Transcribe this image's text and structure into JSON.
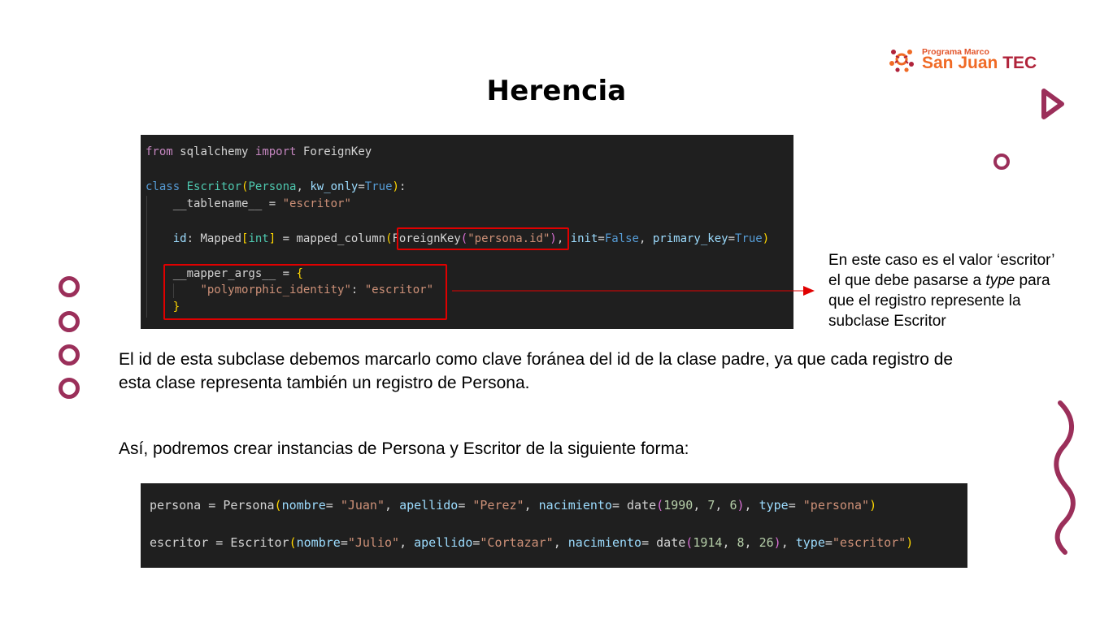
{
  "title": "Herencia",
  "logo": {
    "small": "Programa Marco",
    "name_part1": "San Juan",
    "name_part2": "TEC"
  },
  "code_block_1": {
    "import_from": "from",
    "import_module": "sqlalchemy",
    "import_kw": "import",
    "import_name": "ForeignKey",
    "class_kw": "class",
    "class_name": "Escritor",
    "base_class": "Persona",
    "kw_only_param": "kw_only",
    "kw_only_value": "True",
    "tablename_attr": "__tablename__",
    "tablename_value": "\"escritor\"",
    "id_attr": "id",
    "mapped_type": "Mapped",
    "int_type": "int",
    "mapped_column_fn": "mapped_column",
    "foreignkey_fn": "ForeignKey",
    "foreignkey_arg": "\"persona.id\"",
    "init_param": "init",
    "init_value": "False",
    "pk_param": "primary_key",
    "pk_value": "True",
    "mapper_args_attr": "__mapper_args__",
    "polymorphic_key": "\"polymorphic_identity\"",
    "polymorphic_value": "\"escritor\""
  },
  "note": {
    "line1": "En este caso es el valor ‘escritor’",
    "line2_pre": "el que debe pasarse a ",
    "line2_em": "type",
    "line2_post": " para",
    "line3": "que el registro represente la",
    "line4": "subclase Escritor"
  },
  "paragraph_1": {
    "line1": "El id de esta subclase debemos marcarlo como clave foránea del id de la clase padre, ya que cada registro de",
    "line2": "esta clase representa también un registro de Persona."
  },
  "paragraph_2": "Así, podremos crear instancias de Persona y Escritor de la siguiente forma:",
  "code_block_2": {
    "persona_var": "persona",
    "persona_class": "Persona",
    "persona_nombre_kw": "nombre",
    "persona_nombre": "\"Juan\"",
    "persona_apellido_kw": "apellido",
    "persona_apellido": "\"Perez\"",
    "persona_nac_kw": "nacimiento",
    "date_fn": "date",
    "persona_year": "1990",
    "persona_month": "7",
    "persona_day": "6",
    "persona_type_kw": "type",
    "persona_type": "\"persona\"",
    "escritor_var": "escritor",
    "escritor_class": "Escritor",
    "escritor_nombre": "\"Julio\"",
    "escritor_apellido": "\"Cortazar\"",
    "escritor_year": "1914",
    "escritor_month": "8",
    "escritor_day": "26",
    "escritor_type": "\"escritor\""
  },
  "colors": {
    "accent": "#9b2f5a",
    "highlight_box": "#e00000",
    "code_bg": "#1f1f1f",
    "logo_orange": "#f06a25",
    "logo_red": "#b0233a"
  },
  "icons": [
    "logo-mark-icon",
    "play-triangle-icon",
    "ring-icon",
    "wave-icon",
    "arrow-icon"
  ]
}
